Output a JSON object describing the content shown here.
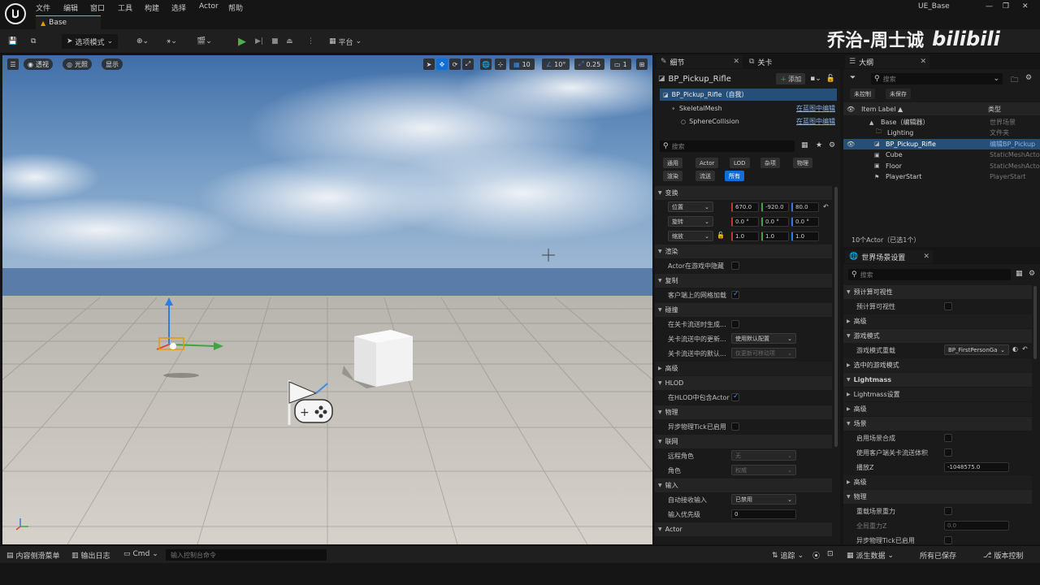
{
  "menu": {
    "items": [
      "文件",
      "编辑",
      "窗口",
      "工具",
      "构建",
      "选择",
      "Actor",
      "帮助"
    ],
    "project_name": "UE_Base"
  },
  "tabs": {
    "level_tab": "Base"
  },
  "toolbar": {
    "mode_label": "选项模式",
    "platform_label": "平台"
  },
  "watermark": {
    "author": "乔治-周士诚",
    "logo": "bilibili"
  },
  "viewport": {
    "perspective_label": "透视",
    "lit_label": "光照",
    "show_label": "显示",
    "grid_snap": "10",
    "rotation_snap": "10°",
    "scale_snap": "0.25",
    "camera_speed": "1"
  },
  "details": {
    "tab_label": "细节",
    "levels_tab_label": "关卡",
    "actor_name": "BP_Pickup_Rifle",
    "add_label": "添加",
    "tree": [
      {
        "label": "BP_Pickup_Rifle（自我）",
        "action": ""
      },
      {
        "label": "SkeletalMesh",
        "action": "在蓝图中编辑"
      },
      {
        "label": "SphereCollision",
        "action": "在蓝图中编辑"
      }
    ],
    "search_placeholder": "搜索",
    "filters_row1": [
      "通用",
      "Actor",
      "LOD",
      "杂项",
      "物理"
    ],
    "filters_row2": [
      "渲染",
      "流送",
      "所有"
    ],
    "active_filter": "所有",
    "transform": {
      "category": "变换",
      "location_label": "位置",
      "rotation_label": "旋转",
      "scale_label": "缩放",
      "location": [
        "670.0",
        "-920.0",
        "80.0"
      ],
      "rotation": [
        "0.0 °",
        "0.0 °",
        "0.0 °"
      ],
      "scale": [
        "1.0",
        "1.0",
        "1.0"
      ]
    },
    "categories": {
      "rendering": "渲染",
      "rendering_hidden": "Actor在游戏中隐藏",
      "replication": "复制",
      "replication_net_load": "客户端上的网格加载",
      "streaming": "碰撞",
      "streaming_gen": "在关卡流送时生成...",
      "streaming_update": "关卡流送中的更新...",
      "streaming_update_value": "使用默认配置",
      "streaming_default": "关卡流送中的默认...",
      "streaming_default_value": "仅更新可移动项",
      "advanced": "高级",
      "hlod": "HLOD",
      "hlod_include": "在HLOD中包含Actor",
      "physics": "物理",
      "physics_async": "异步物理Tick已启用",
      "network": "联网",
      "remote_role": "远程角色",
      "remote_role_value": "无",
      "role": "角色",
      "role_value": "权威",
      "input": "输入",
      "auto_receive": "自动接收输入",
      "auto_receive_value": "已禁用",
      "input_priority": "输入优先级",
      "input_priority_value": "0",
      "actor": "Actor"
    }
  },
  "outliner": {
    "tab_label": "大纲",
    "search_placeholder": "搜索",
    "unsaved_btn": "未控制",
    "unsaved_btn2": "未保存",
    "col_item": "Item Label ▲",
    "col_type": "类型",
    "rows": [
      {
        "label": "Base（编辑器）",
        "type": "世界场景"
      },
      {
        "label": "Lighting",
        "type": "文件夹"
      },
      {
        "label": "BP_Pickup_Rifle",
        "type": "编辑BP_Pickup"
      },
      {
        "label": "Cube",
        "type": "StaticMeshActo"
      },
      {
        "label": "Floor",
        "type": "StaticMeshActo"
      },
      {
        "label": "PlayerStart",
        "type": "PlayerStart"
      }
    ],
    "selected_index": 2,
    "count_text": "10个Actor（已选1个）"
  },
  "world_settings": {
    "tab_label": "世界场景设置",
    "search_placeholder": "搜索",
    "rows": {
      "precomputed_visibility_cat": "预计算可视性",
      "precomputed_visibility": "预计算可视性",
      "advanced1": "高级",
      "game_mode_cat": "游戏模式",
      "game_mode_override": "游戏模式重载",
      "game_mode_value": "BP_FirstPersonGa",
      "selected_game_mode": "选中的游戏模式",
      "lightmass_cat": "Lightmass",
      "lightmass_settings": "Lightmass设置",
      "advanced2": "高级",
      "world_cat": "场景",
      "enable_world_composition": "启用场景合成",
      "use_client_streaming": "使用客户端关卡流送体积",
      "kill_z": "播放Z",
      "kill_z_value": "-1048575.0",
      "advanced3": "高级",
      "physics_cat": "物理",
      "override_gravity": "重载场景重力",
      "global_gravity": "全局重力Z",
      "global_gravity_value": "0.0",
      "async_physics": "异步物理Tick已启用"
    }
  },
  "statusbar": {
    "content_drawer": "内容侧滑菜单",
    "output_log": "输出日志",
    "cmd": "Cmd",
    "console_placeholder": "输入控制台命令",
    "trace": "追踪",
    "derived_data": "派生数据",
    "all_saved": "所有已保存",
    "source_control": "版本控制"
  },
  "colors": {
    "accent": "#0e6fd8",
    "selection": "#264f78",
    "play_green": "#4caf50",
    "panel_bg": "#1a1a1a"
  }
}
